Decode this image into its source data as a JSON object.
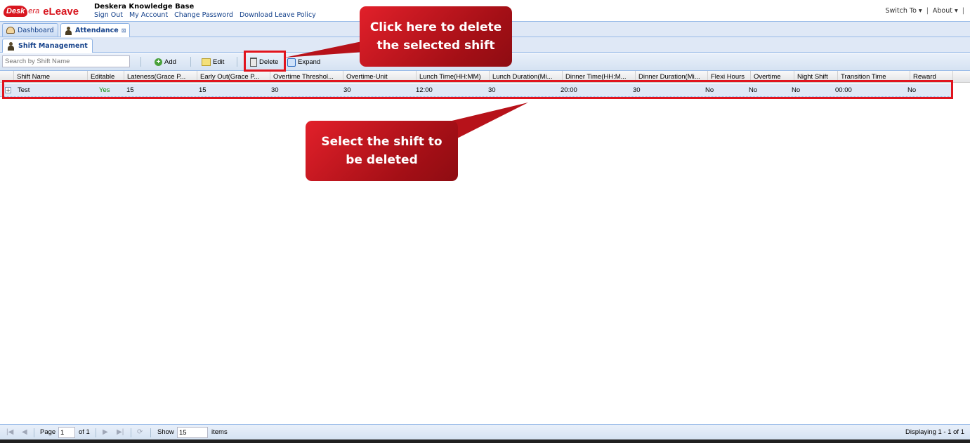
{
  "header": {
    "logo_badge": "Desk",
    "logo_rest": "era",
    "app_name": "eLeave",
    "company": "Deskera Knowledge Base",
    "links": [
      "Sign Out",
      "My Account",
      "Change Password",
      "Download Leave Policy"
    ],
    "switch_to": "Switch To ▾",
    "about": "About ▾"
  },
  "tabs": [
    {
      "label": "Dashboard",
      "icon": "dashboard-icon"
    },
    {
      "label": "Attendance",
      "icon": "user-icon",
      "active": true
    }
  ],
  "subtab": {
    "label": "Shift Management",
    "icon": "user-icon"
  },
  "toolbar": {
    "search_placeholder": "Search by Shift Name",
    "add_label": "Add",
    "edit_label": "Edit",
    "delete_label": "Delete",
    "expand_label": "Expand"
  },
  "grid": {
    "columns": [
      "Shift Name",
      "Editable",
      "Lateness(Grace P...",
      "Early Out(Grace P...",
      "Overtime Threshol...",
      "Overtime-Unit",
      "Lunch Time(HH:MM)",
      "Lunch Duration(Mi...",
      "Dinner Time(HH:M...",
      "Dinner Duration(Mi...",
      "Flexi Hours",
      "Overtime",
      "Night Shift",
      "Transition Time",
      "Reward"
    ],
    "rows": [
      {
        "cells": [
          "Test",
          "Yes",
          "15",
          "15",
          "30",
          "30",
          "12:00",
          "30",
          "20:00",
          "30",
          "No",
          "No",
          "No",
          "00:00",
          "No"
        ]
      }
    ]
  },
  "pager": {
    "page_label": "Page",
    "page_value": "1",
    "of_label": "of 1",
    "show_label": "Show",
    "show_value": "15",
    "items_label": "items",
    "displaying": "Displaying 1 - 1 of 1"
  },
  "annotations": {
    "delete_callout": "Click here to delete the selected shift",
    "select_callout": "Select the shift to be deleted",
    "color": "#e0141e"
  }
}
